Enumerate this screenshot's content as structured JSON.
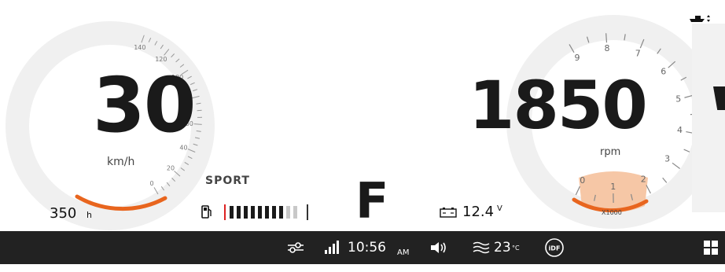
{
  "speedometer": {
    "value": "30",
    "unit": "km/h",
    "ticks": [
      "20",
      "40",
      "60",
      "80",
      "100",
      "120",
      "140",
      "0"
    ]
  },
  "tachometer": {
    "value": "1850",
    "unit": "rpm",
    "multiplier": "X1000",
    "ticks": [
      "0",
      "1",
      "2",
      "3",
      "4",
      "5",
      "6",
      "7",
      "8",
      "9"
    ]
  },
  "drive_mode": "SPORT",
  "gear": "F",
  "engine_hours": {
    "value": "350",
    "unit": "h"
  },
  "fuel": {
    "level_segments_filled": 8,
    "total_segments": 10
  },
  "battery": {
    "value": "12.4",
    "unit": "V"
  },
  "status_bar": {
    "time": "10:56",
    "ampm": "AM",
    "water_temp": "23",
    "water_temp_unit": "°C",
    "idf_label": "iDF"
  },
  "colors": {
    "accent": "#e8651e",
    "accent_light": "#f6c7a6",
    "text": "#1a1a1a",
    "status_bar": "#222222"
  }
}
